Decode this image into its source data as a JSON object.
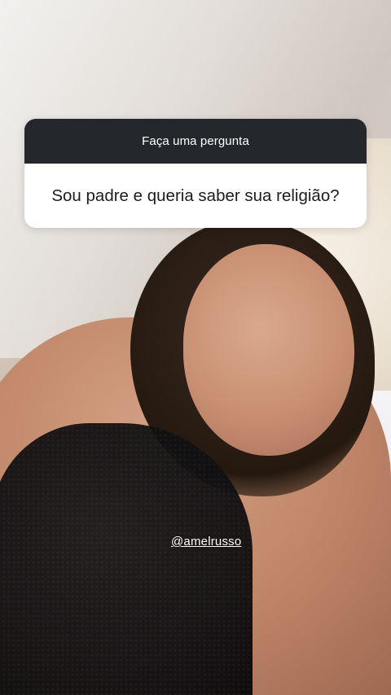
{
  "question_sticker": {
    "header": "Faça uma pergunta",
    "question": "Sou padre e queria saber sua religião?"
  },
  "mention": {
    "handle": "@amelrusso"
  },
  "colors": {
    "sticker_header_bg": "#24282d",
    "sticker_body_bg": "#ffffff",
    "mention_text": "#ffffff"
  }
}
